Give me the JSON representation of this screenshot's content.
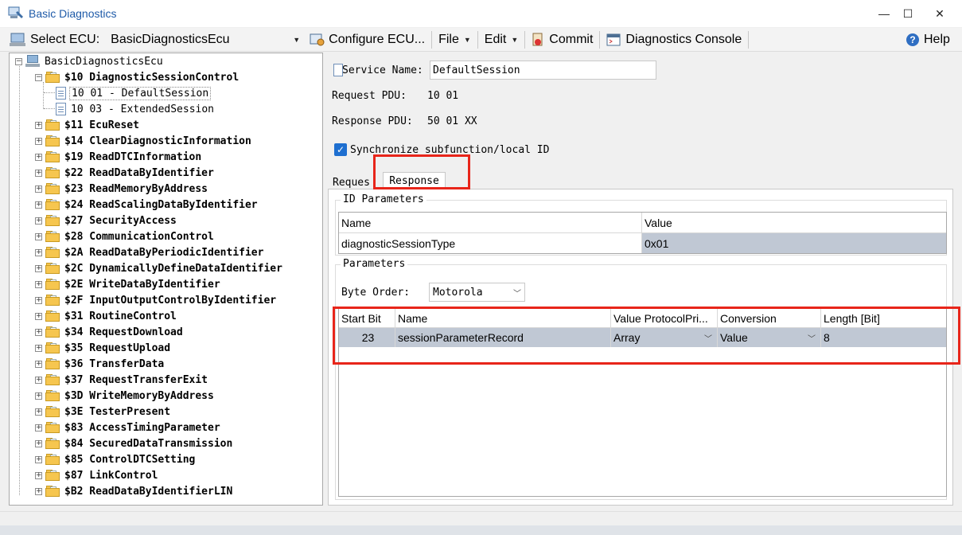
{
  "window": {
    "title": "Basic Diagnostics",
    "controls": [
      "—",
      "☐",
      "✕"
    ]
  },
  "toolbar": {
    "select_ecu_label": "Select ECU:",
    "ecu_value": "BasicDiagnosticsEcu",
    "configure_ecu": "Configure ECU...",
    "file": "File",
    "edit": "Edit",
    "commit": "Commit",
    "diag_console": "Diagnostics Console",
    "help": "Help"
  },
  "tree": {
    "root": "BasicDiagnosticsEcu",
    "expanded_service": "$10 DiagnosticSessionControl",
    "children": [
      "10 01 - DefaultSession",
      "10 03 - ExtendedSession"
    ],
    "services": [
      "$11 EcuReset",
      "$14 ClearDiagnosticInformation",
      "$19 ReadDTCInformation",
      "$22 ReadDataByIdentifier",
      "$23 ReadMemoryByAddress",
      "$24 ReadScalingDataByIdentifier",
      "$27 SecurityAccess",
      "$28 CommunicationControl",
      "$2A ReadDataByPeriodicIdentifier",
      "$2C DynamicallyDefineDataIdentifier",
      "$2E WriteDataByIdentifier",
      "$2F InputOutputControlByIdentifier",
      "$31 RoutineControl",
      "$34 RequestDownload",
      "$35 RequestUpload",
      "$36 TransferData",
      "$37 RequestTransferExit",
      "$3D WriteMemoryByAddress",
      "$3E TesterPresent",
      "$83 AccessTimingParameter",
      "$84 SecuredDataTransmission",
      "$85 ControlDTCSetting",
      "$87 LinkControl",
      "$B2 ReadDataByIdentifierLIN"
    ]
  },
  "details": {
    "service_name_label": "Service Name:",
    "service_name_value": "DefaultSession",
    "request_pdu_label": "Request PDU:",
    "request_pdu_value": "10 01",
    "response_pdu_label": "Response PDU:",
    "response_pdu_value": "50 01 XX",
    "sync_label": "Synchronize subfunction/local ID",
    "sync_checked": true
  },
  "tabs": {
    "request": "Reques",
    "response": "Response"
  },
  "id_parameters": {
    "title": "ID Parameters",
    "headers": [
      "Name",
      "Value"
    ],
    "rows": [
      [
        "diagnosticSessionType",
        "0x01"
      ]
    ]
  },
  "parameters": {
    "title": "Parameters",
    "byte_order_label": "Byte Order:",
    "byte_order_value": "Motorola",
    "headers": [
      "Start Bit",
      "Name",
      "Value ProtocolPri...",
      "Conversion",
      "Length [Bit]"
    ],
    "rows": [
      [
        "23",
        "sessionParameterRecord",
        "Array",
        "Value",
        "8"
      ]
    ]
  },
  "colors": {
    "highlight_red": "#e8251a",
    "selection": "#c0c8d4",
    "title_text": "#1e5aa8",
    "checkbox_blue": "#1e6fd0"
  }
}
